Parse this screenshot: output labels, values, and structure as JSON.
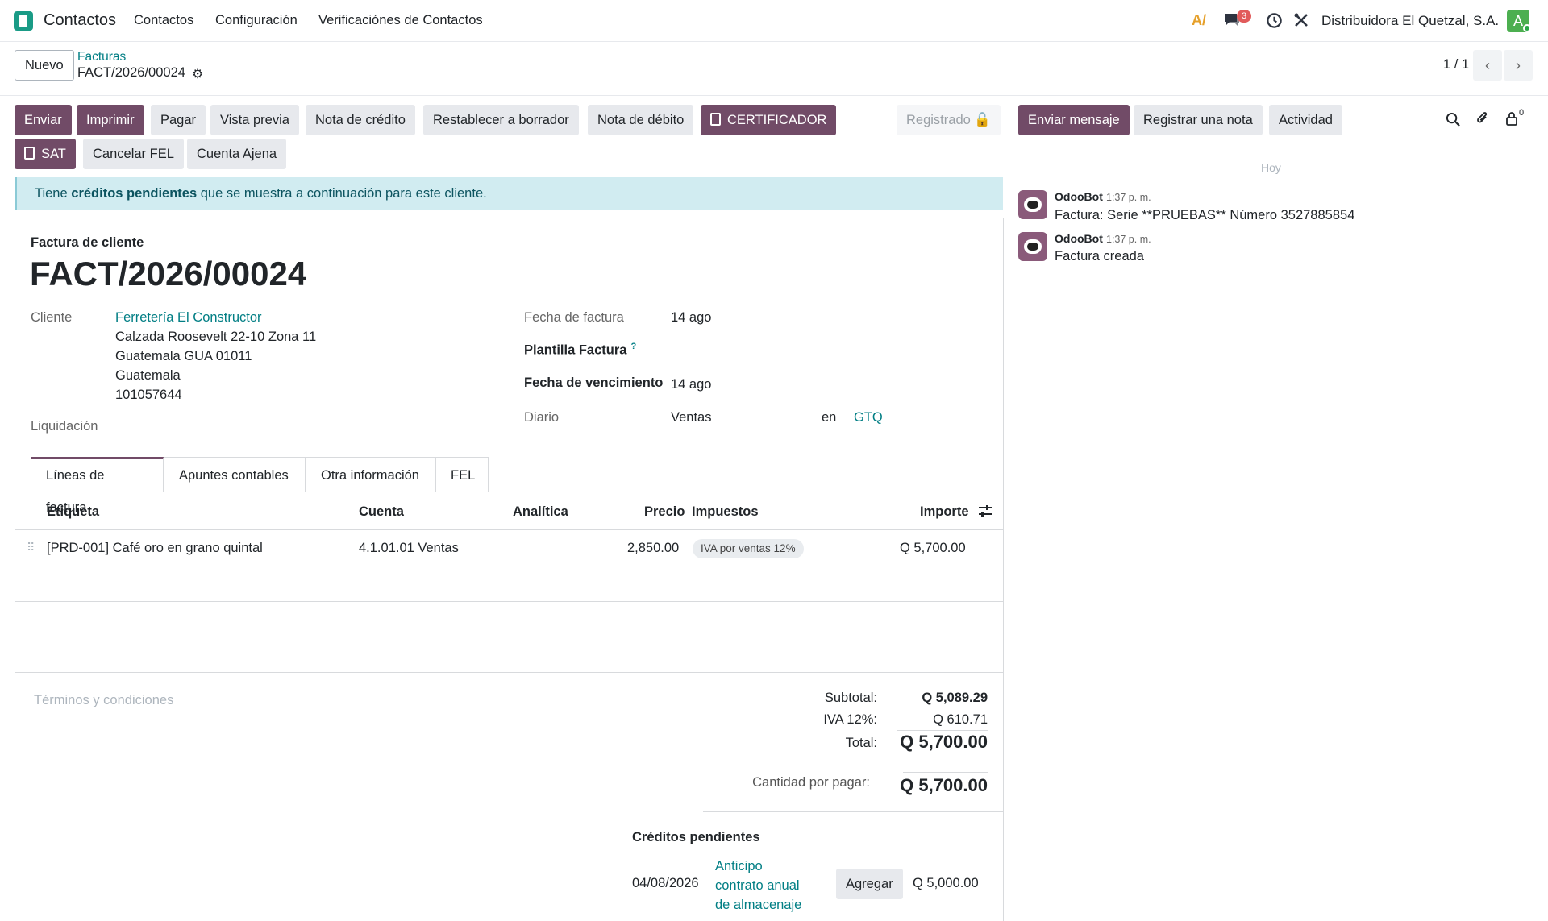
{
  "navbar": {
    "app_name": "Contactos",
    "menu": [
      "Contactos",
      "Configuración",
      "Verificaciónes de Contactos"
    ],
    "messages_count": "3",
    "company": "Distribuidora El Quetzal, S.A.",
    "avatar_letter": "A"
  },
  "control_panel": {
    "new_button": "Nuevo",
    "breadcrumb_parent": "Facturas",
    "breadcrumb_current": "FACT/2026/00024",
    "pager": "1 / 1"
  },
  "actions": {
    "enviar": "Enviar",
    "imprimir": "Imprimir",
    "pagar": "Pagar",
    "vista_previa": "Vista previa",
    "nota_credito": "Nota de crédito",
    "restablecer": "Restablecer a borrador",
    "nota_debito": "Nota de débito",
    "certificador": "CERTIFICADOR",
    "registrado": "Registrado",
    "sat": "SAT",
    "cancelar_fel": "Cancelar FEL",
    "cuenta_ajena": "Cuenta Ajena"
  },
  "alert": {
    "prefix": "Tiene",
    "bold": "créditos pendientes",
    "suffix": "que se muestra a continuación para este cliente."
  },
  "invoice": {
    "type_label": "Factura de cliente",
    "number": "FACT/2026/00024",
    "cliente_label": "Cliente",
    "cliente_name": "Ferretería El Constructor",
    "address": [
      "Calzada Roosevelt 22-10 Zona 11",
      "Guatemala GUA 01011",
      "Guatemala",
      "101057644"
    ],
    "liquidacion_label": "Liquidación",
    "fecha_factura_label": "Fecha de factura",
    "fecha_factura": "14 ago",
    "plantilla_label": "Plantilla Factura",
    "plantilla_help": "?",
    "fecha_venc_label": "Fecha de vencimiento",
    "fecha_venc": "14 ago",
    "diario_label": "Diario",
    "diario": "Ventas",
    "en": "en",
    "moneda": "GTQ"
  },
  "tabs": [
    "Líneas de factura",
    "Apuntes contables",
    "Otra información",
    "FEL"
  ],
  "lines_table": {
    "headers": [
      "Etiqueta",
      "Cuenta",
      "Analítica",
      "Precio",
      "Impuestos",
      "Importe"
    ],
    "rows": [
      {
        "etiqueta": "[PRD-001] Café oro en grano quintal",
        "cuenta": "4.1.01.01 Ventas",
        "analitica": "",
        "precio": "2,850.00",
        "impuestos": "IVA por ventas 12%",
        "importe": "Q 5,700.00"
      }
    ]
  },
  "terms_placeholder": "Términos y condiciones",
  "totals": {
    "subtotal_label": "Subtotal:",
    "subtotal": "Q 5,089.29",
    "iva_label": "IVA 12%:",
    "iva": "Q 610.71",
    "total_label": "Total:",
    "total": "Q 5,700.00",
    "por_pagar_label": "Cantidad por pagar:",
    "por_pagar": "Q 5,700.00"
  },
  "creditos": {
    "title": "Créditos pendientes",
    "items": [
      {
        "fecha": "04/08/2026",
        "desc_lines": [
          "Anticipo",
          "contrato anual",
          "de almacenaje"
        ],
        "button": "Agregar",
        "monto": "Q 5,000.00"
      }
    ]
  },
  "chatter": {
    "enviar_mensaje": "Enviar mensaje",
    "registrar_nota": "Registrar una nota",
    "actividad": "Actividad",
    "followers_count": "0",
    "date_separator": "Hoy",
    "messages": [
      {
        "author": "OdooBot",
        "time": "1:37 p. m.",
        "body": "Factura: Serie **PRUEBAS** Número 3527885854"
      },
      {
        "author": "OdooBot",
        "time": "1:37 p. m.",
        "body": "Factura creada"
      }
    ]
  },
  "colors": {
    "primary": "#714b67",
    "link": "#017e84",
    "alert_bg": "#d1ecf1"
  }
}
